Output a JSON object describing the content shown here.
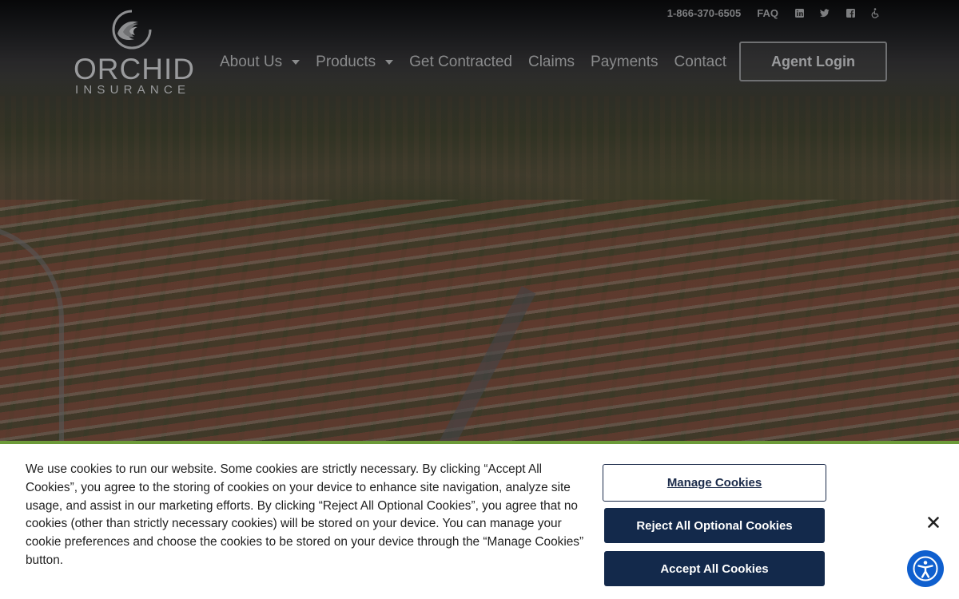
{
  "topbar": {
    "phone": "1-866-370-6505",
    "faq": "FAQ",
    "social_icons": [
      "linkedin-icon",
      "twitter-icon",
      "facebook-icon",
      "accessibility-icon"
    ]
  },
  "logo": {
    "name": "ORCHID",
    "tagline": "INSURANCE"
  },
  "nav": {
    "items": [
      {
        "label": "About Us",
        "dropdown": true
      },
      {
        "label": "Products",
        "dropdown": true
      },
      {
        "label": "Get Contracted",
        "dropdown": false
      },
      {
        "label": "Claims",
        "dropdown": false
      },
      {
        "label": "Payments",
        "dropdown": false
      },
      {
        "label": "Contact",
        "dropdown": false
      }
    ],
    "agent_login": "Agent Login"
  },
  "cookie_banner": {
    "text": "We use cookies to run our website. Some cookies are strictly necessary. By clicking “Accept All Cookies”, you agree to the storing of cookies on your device to enhance site navigation, analyze site usage, and assist in our marketing efforts. By clicking “Reject All Optional Cookies”, you agree that no cookies (other than strictly necessary cookies) will be stored on your device. You can manage your cookie preferences and choose the cookies to be stored on your device through the “Manage Cookies” button.",
    "manage_label": "Manage Cookies",
    "reject_label": "Reject All Optional Cookies",
    "accept_label": "Accept All Cookies"
  },
  "colors": {
    "accent_green": "#6c9a38",
    "button_navy": "#13294b",
    "accessibility_blue": "#0f5fce"
  }
}
